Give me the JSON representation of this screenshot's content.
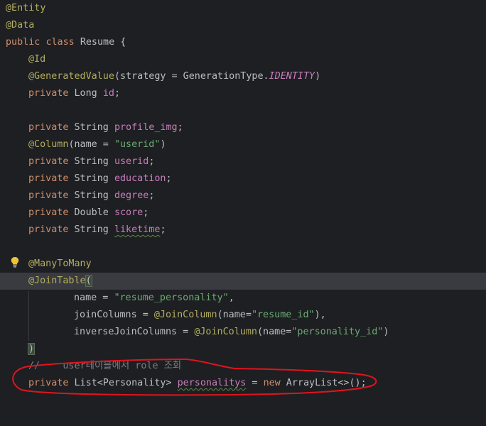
{
  "editor": {
    "lines": {
      "l1": {
        "ann": "@Entity"
      },
      "l2": {
        "ann": "@Data"
      },
      "l3": {
        "kw1": "public",
        "kw2": "class",
        "name": "Resume",
        "brace": "{"
      },
      "l4": {
        "ann": "@Id"
      },
      "l5": {
        "ann": "@GeneratedValue",
        "open": "(strategy = GenerationType.",
        "enum": "IDENTITY",
        "close": ")"
      },
      "l6": {
        "kw": "private",
        "type": "Long",
        "field": "id",
        "end": ";"
      },
      "l8": {
        "kw": "private",
        "type": "String",
        "field": "profile_img",
        "end": ";"
      },
      "l9": {
        "ann": "@Column",
        "open": "(name = ",
        "str": "\"userid\"",
        "close": ")"
      },
      "l10": {
        "kw": "private",
        "type": "String",
        "field": "userid",
        "end": ";"
      },
      "l11": {
        "kw": "private",
        "type": "String",
        "field": "education",
        "end": ";"
      },
      "l12": {
        "kw": "private",
        "type": "String",
        "field": "degree",
        "end": ";"
      },
      "l13": {
        "kw": "private",
        "type": "Double",
        "field": "score",
        "end": ";"
      },
      "l14": {
        "kw": "private",
        "type": "String",
        "field": "liketime",
        "end": ";"
      },
      "l16": {
        "ann": "@ManyToMany"
      },
      "l17": {
        "ann": "@JoinTable",
        "paren": "("
      },
      "l18": {
        "key": "name = ",
        "str": "\"resume_personality\"",
        "end": ","
      },
      "l19": {
        "key": "joinColumns = ",
        "ann": "@JoinColumn",
        "open": "(name=",
        "str": "\"resume_id\"",
        "close": "),"
      },
      "l20": {
        "key": "inverseJoinColumns = ",
        "ann": "@JoinColumn",
        "open": "(name=",
        "str": "\"personality_id\"",
        "close": ")"
      },
      "l21": {
        "paren": ")"
      },
      "l22": {
        "comment": "//    user테이블에서 role 조회"
      },
      "l23": {
        "kw": "private",
        "type": "List<Personality>",
        "field": "personalitys",
        "eq": " = ",
        "kw2": "new",
        "rest": " ArrayList<>();"
      }
    }
  },
  "icons": {
    "bulb": "lightbulb-icon"
  },
  "colors": {
    "background": "#1e1f22",
    "annotation": "#b3ae60",
    "keyword": "#cf8e6d",
    "field": "#c77dbb",
    "string": "#6aab73",
    "comment": "#7a7e85",
    "markup": "#e0141e"
  }
}
